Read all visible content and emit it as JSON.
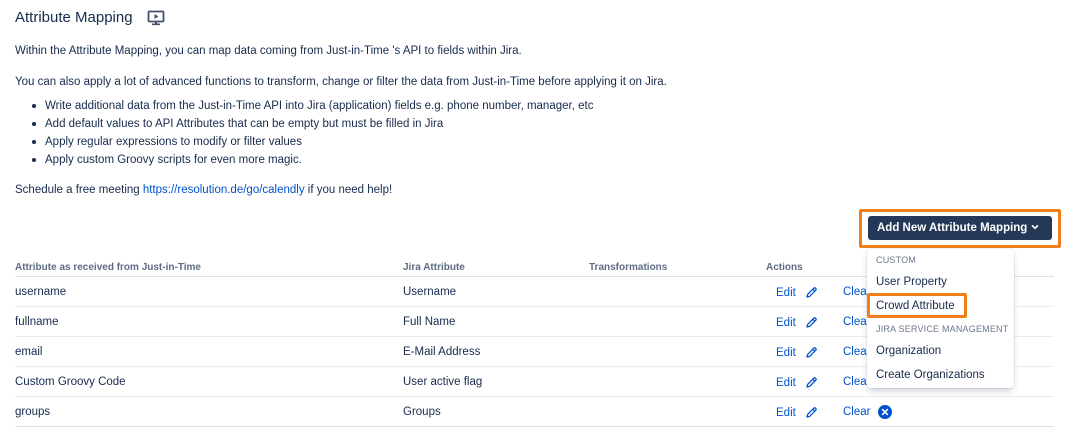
{
  "header": {
    "title": "Attribute Mapping",
    "icon": "monitor-icon"
  },
  "intro": {
    "line1": "Within the Attribute Mapping, you can map data coming from Just-in-Time 's API to fields within Jira.",
    "line2": "You can also apply a lot of advanced functions to transform, change or filter the data from Just-in-Time before applying it on Jira.",
    "bullets": [
      "Write additional data from the Just-in-Time API into Jira (application) fields e.g. phone number, manager, etc",
      "Add default values to API Attributes that can be empty but must be filled in Jira",
      "Apply regular expressions to modify or filter values",
      "Apply custom Groovy scripts for even more magic."
    ],
    "schedule_prefix": "Schedule a free meeting ",
    "schedule_link": "https://resolution.de/go/calendly",
    "schedule_suffix": " if you need help!"
  },
  "add_button": {
    "label": "Add New Attribute Mapping",
    "bg_color": "#253858",
    "highlight_color": "#f07f1a"
  },
  "dropdown": {
    "group1": "CUSTOM",
    "item1": "User Property",
    "item2": "Crowd Attribute",
    "group2": "JIRA SERVICE MANAGEMENT",
    "item3": "Organization",
    "item4": "Create Organizations"
  },
  "table": {
    "headers": {
      "attribute": "Attribute as received from Just-in-Time",
      "jira": "Jira Attribute",
      "transformations": "Transformations",
      "actions": "Actions"
    },
    "edit_label": "Edit",
    "clear_label": "Clear",
    "rows": [
      {
        "attribute": "username",
        "jira": "Username",
        "transformations": ""
      },
      {
        "attribute": "fullname",
        "jira": "Full Name",
        "transformations": ""
      },
      {
        "attribute": "email",
        "jira": "E-Mail Address",
        "transformations": ""
      },
      {
        "attribute": "Custom Groovy Code",
        "jira": "User active flag",
        "transformations": ""
      },
      {
        "attribute": "groups",
        "jira": "Groups",
        "transformations": ""
      }
    ]
  },
  "colors": {
    "link": "#0052cc",
    "text": "#172b4d"
  }
}
